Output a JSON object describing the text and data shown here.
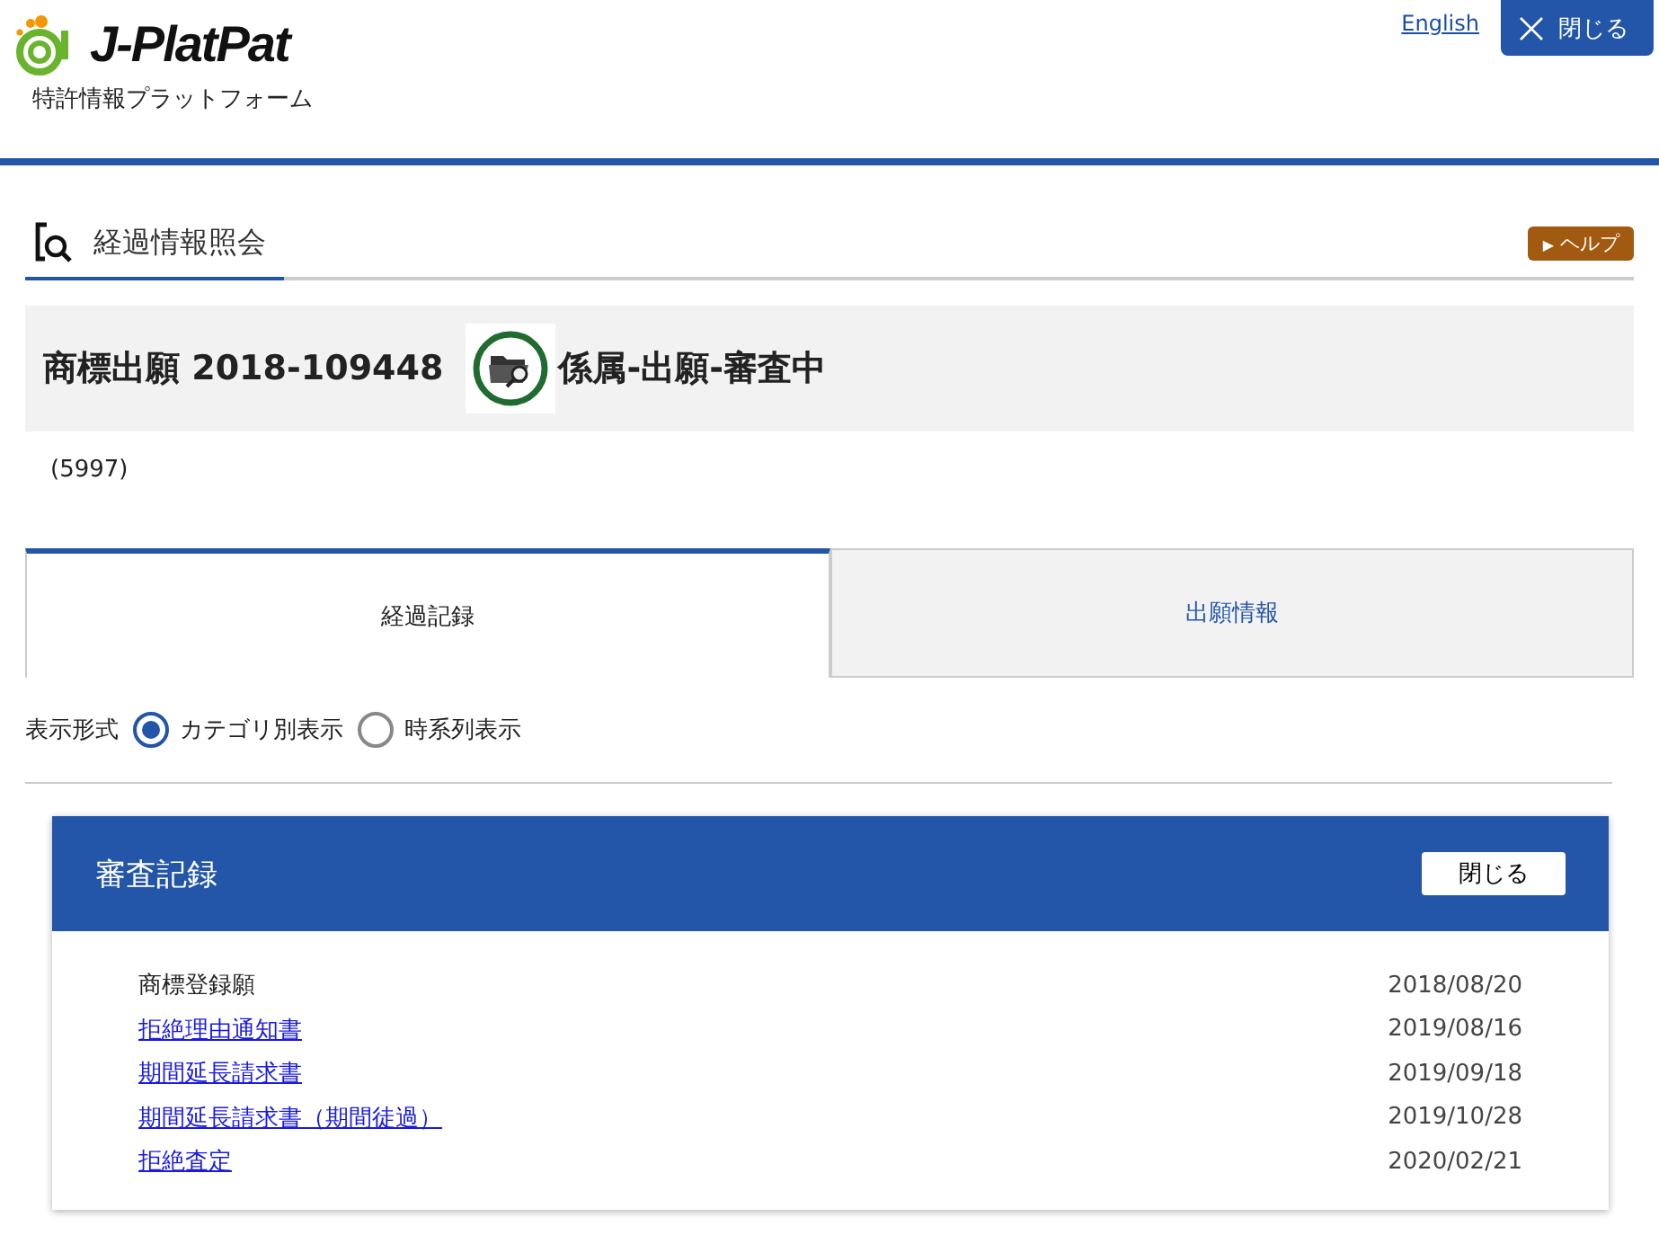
{
  "header": {
    "logo_text": "J-PlatPat",
    "logo_subtitle": "特許情報プラットフォーム",
    "language_link": "English",
    "close_button": "閉じる"
  },
  "page_title": "経過情報照会",
  "help_button": "ヘルプ",
  "help_marker": "▶",
  "application": {
    "title": "商標出願 2018-109448",
    "status": "係属-出願-審査中",
    "note": "(5997)"
  },
  "tabs": [
    {
      "label": "経過記録",
      "selected": true
    },
    {
      "label": "出願情報",
      "selected": false
    }
  ],
  "display_mode": {
    "label": "表示形式",
    "options": [
      {
        "label": "カテゴリ別表示",
        "selected": true
      },
      {
        "label": "時系列表示",
        "selected": false
      }
    ]
  },
  "section": {
    "title": "審査記録",
    "close_button": "閉じる",
    "records": [
      {
        "name": "商標登録願",
        "date": "2018/08/20",
        "kind": "text"
      },
      {
        "name": "拒絶理由通知書",
        "date": "2019/08/16",
        "kind": "link"
      },
      {
        "name": "期間延長請求書",
        "date": "2019/09/18",
        "kind": "link"
      },
      {
        "name": "期間延長請求書（期間徒過）",
        "date": "2019/10/28",
        "kind": "link"
      },
      {
        "name": "拒絶査定",
        "date": "2020/02/21",
        "kind": "link"
      }
    ]
  }
}
